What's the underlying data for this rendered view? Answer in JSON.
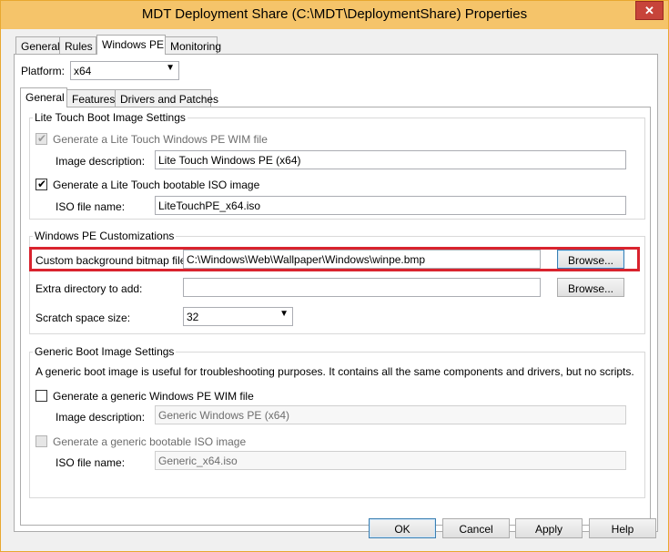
{
  "window": {
    "title": "MDT Deployment Share (C:\\MDT\\DeploymentShare) Properties",
    "close_glyph": "✕"
  },
  "outer_tabs": [
    "General",
    "Rules",
    "Windows PE",
    "Monitoring"
  ],
  "platform": {
    "label": "Platform:",
    "value": "x64"
  },
  "inner_tabs": [
    "General",
    "Features",
    "Drivers and Patches"
  ],
  "lite_touch": {
    "group_label": "Lite Touch Boot Image Settings",
    "wim_checkbox_label": "Generate a Lite Touch Windows PE WIM file",
    "image_description_label": "Image description:",
    "image_description_value": "Lite Touch Windows PE (x64)",
    "iso_checkbox_label": "Generate a Lite Touch bootable ISO image",
    "iso_file_label": "ISO file name:",
    "iso_file_value": "LiteTouchPE_x64.iso"
  },
  "customizations": {
    "group_label": "Windows PE Customizations",
    "bitmap_label": "Custom background bitmap file:",
    "bitmap_value": "C:\\Windows\\Web\\Wallpaper\\Windows\\winpe.bmp",
    "browse_label": "Browse...",
    "extra_dir_label": "Extra directory to add:",
    "extra_dir_value": "",
    "scratch_label": "Scratch space size:",
    "scratch_value": "32"
  },
  "generic": {
    "group_label": "Generic Boot Image Settings",
    "description": "A generic boot image is useful for troubleshooting purposes.  It contains all the same components and drivers, but no scripts.",
    "wim_checkbox_label": "Generate a generic Windows PE WIM file",
    "image_description_label": "Image description:",
    "image_description_value": "Generic Windows PE (x64)",
    "iso_checkbox_label": "Generate a generic bootable ISO image",
    "iso_file_label": "ISO file name:",
    "iso_file_value": "Generic_x64.iso"
  },
  "footer": {
    "ok": "OK",
    "cancel": "Cancel",
    "apply": "Apply",
    "help": "Help"
  },
  "checkmark_glyph": "✔",
  "dropdown_glyph": "▼",
  "colors": {
    "title_bar": "#f5c46a",
    "close_button": "#c7443a",
    "highlight": "#d9232e"
  }
}
